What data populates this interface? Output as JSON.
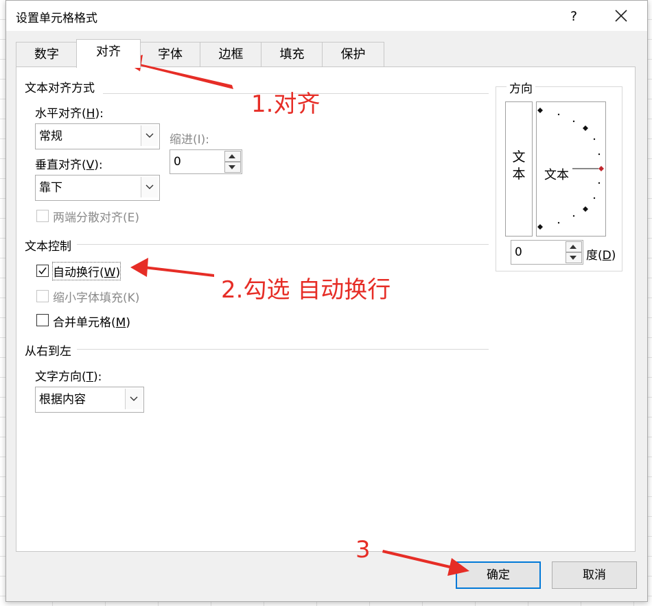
{
  "dialog": {
    "title": "设置单元格格式",
    "help": "?",
    "tabs": [
      {
        "label": "数字",
        "active": false
      },
      {
        "label": "对齐",
        "active": true
      },
      {
        "label": "字体",
        "active": false
      },
      {
        "label": "边框",
        "active": false
      },
      {
        "label": "填充",
        "active": false
      },
      {
        "label": "保护",
        "active": false
      }
    ]
  },
  "alignment": {
    "group_label": "文本对齐方式",
    "horizontal": {
      "label": "水平对齐(",
      "key": "H",
      "label_end": "):",
      "value": "常规"
    },
    "indent": {
      "label": "缩进(I):",
      "value": "0"
    },
    "vertical": {
      "label": "垂直对齐(",
      "key": "V",
      "label_end": "):",
      "value": "靠下"
    },
    "justify_distributed": {
      "label": "两端分散对齐(E)",
      "checked": false,
      "disabled": true
    }
  },
  "text_control": {
    "group_label": "文本控制",
    "wrap_text": {
      "label": "自动换行(",
      "key": "W",
      "label_end": ")",
      "checked": true
    },
    "shrink_to_fit": {
      "label": "缩小字体填充(K)",
      "checked": false,
      "disabled": true
    },
    "merge_cells": {
      "label": "合并单元格(",
      "key": "M",
      "label_end": ")",
      "checked": false
    }
  },
  "rtl": {
    "group_label": "从右到左",
    "direction": {
      "label": "文字方向(",
      "key": "T",
      "label_end": "):",
      "value": "根据内容"
    }
  },
  "orientation": {
    "group_label": "方向",
    "vertical_text": "文\n本",
    "dial_text": "文本",
    "degrees": "0",
    "degrees_label": "度(",
    "degrees_key": "D",
    "degrees_label_end": ")"
  },
  "buttons": {
    "ok": "确定",
    "cancel": "取消"
  },
  "annotations": {
    "step1": "1.对齐",
    "step2": "2.勾选 自动换行",
    "step3": "3",
    "color": "#e62d26"
  },
  "colors": {
    "accent": "#0078d7",
    "diamond_red": "#c0262d"
  }
}
